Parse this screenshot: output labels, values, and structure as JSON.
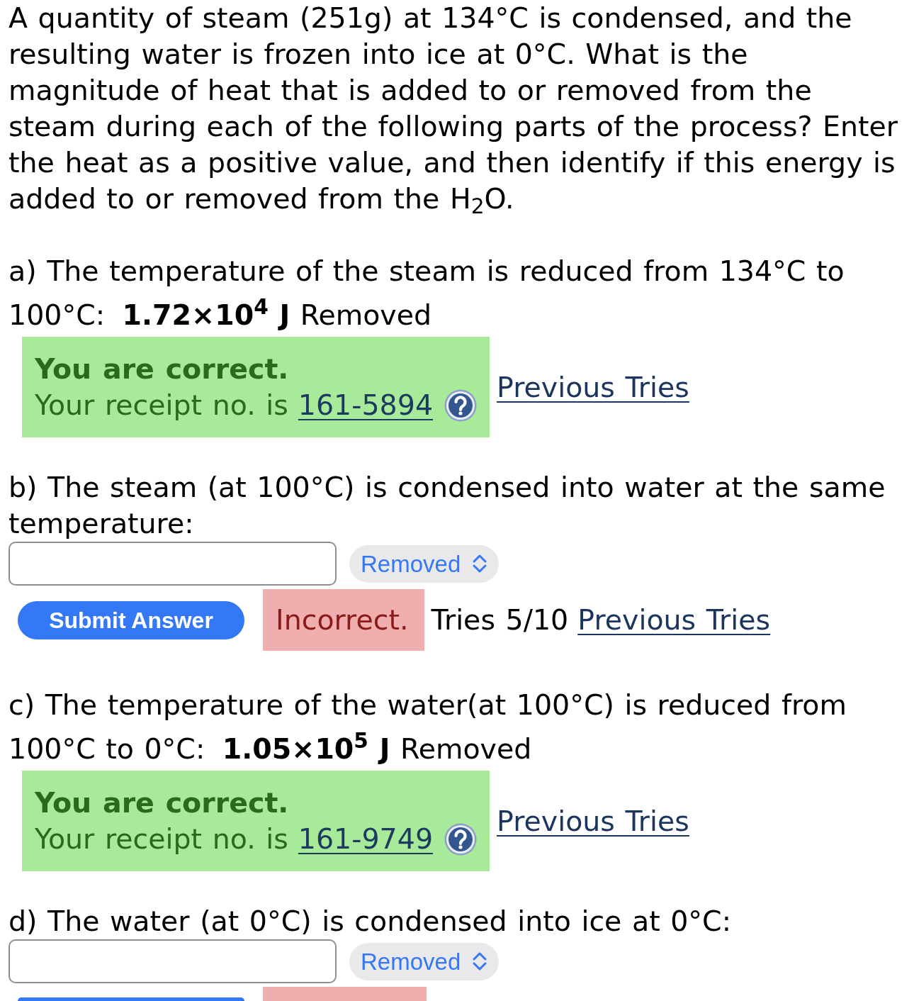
{
  "intro": "A quantity of steam (251g) at 134°C is condensed, and the resulting water is frozen into ice at 0°C. What is the magnitude of heat that is added to or removed from the steam during each of the following parts of the process? Enter the heat as a positive value, and then identify if this energy is added to or removed from the H$_{2}$O.",
  "parts": [
    {
      "kind": "answered",
      "question": "a) The temperature of the steam is reduced from 134°C to 100°C: **1.72×10$^{4}$ J** Removed",
      "feedback": {
        "kind": "correct",
        "title": "You are correct.",
        "receipt_label": "Your receipt no. is",
        "receipt_number": "161-5894"
      },
      "previous_tries": "Previous Tries"
    },
    {
      "kind": "open",
      "question": "b) The steam (at 100°C) is condensed into water at the same temperature:",
      "direction": "Removed",
      "submit": {
        "label": "Submit Answer"
      },
      "feedback": {
        "kind": "incorrect",
        "text": "Incorrect."
      },
      "tries": "Tries 5/10",
      "previous_tries": "Previous Tries"
    },
    {
      "kind": "answered",
      "question": "c) The temperature of the water(at 100°C) is reduced from 100°C to 0°C: **1.05×10$^{5}$ J** Removed",
      "feedback": {
        "kind": "correct",
        "title": "You are correct.",
        "receipt_label": "Your receipt no. is",
        "receipt_number": "161-9749"
      },
      "previous_tries": "Previous Tries"
    },
    {
      "kind": "open",
      "question": "d) The water (at 0°C) is condensed into ice at 0°C:",
      "direction": "Removed",
      "submit": {
        "cut_off": true
      },
      "feedback": {
        "kind": "incorrect",
        "cut_off": true
      }
    }
  ]
}
